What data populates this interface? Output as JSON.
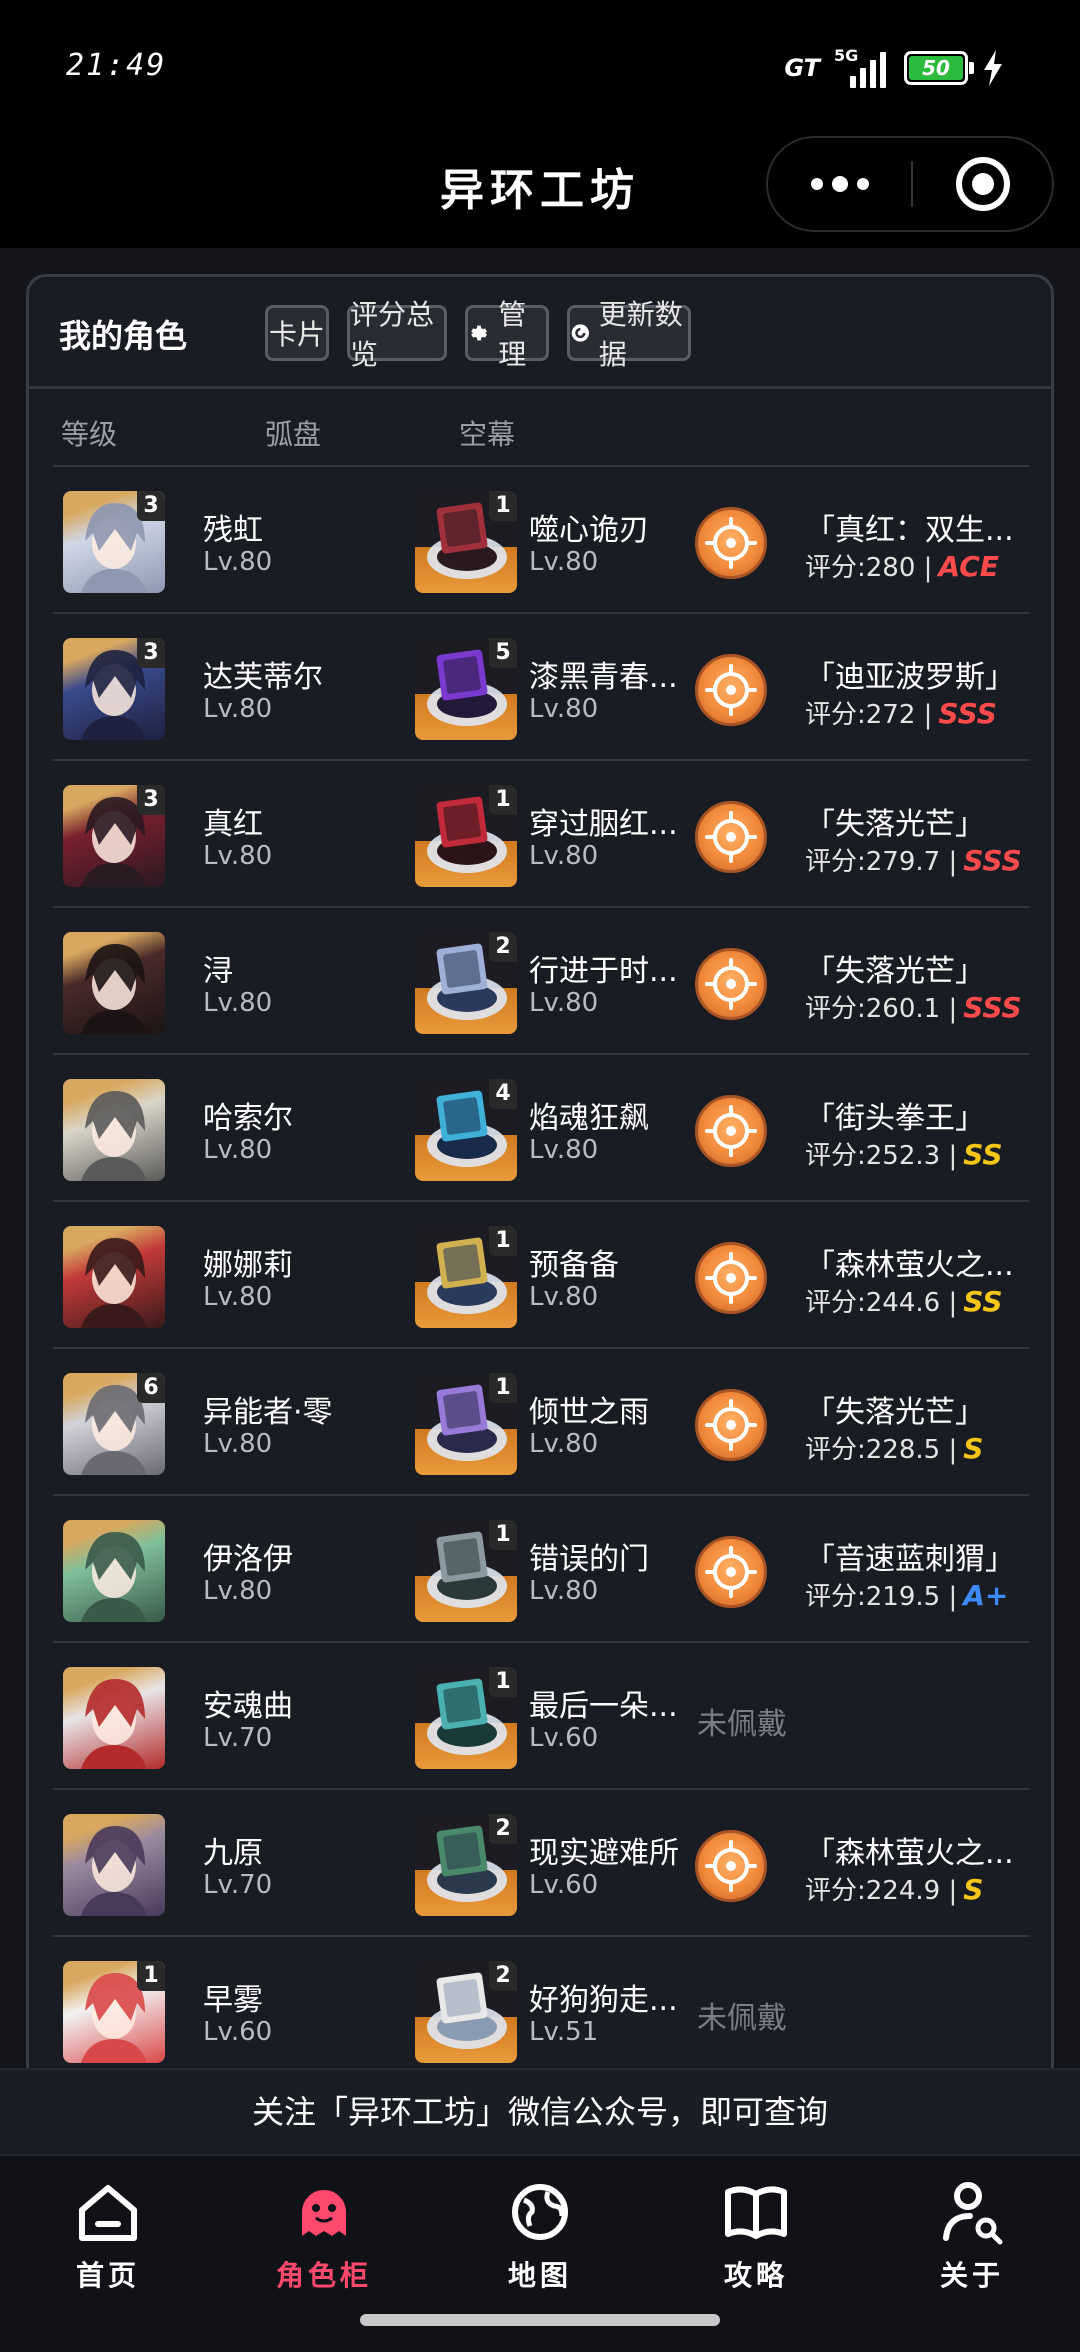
{
  "status": {
    "time": "21:49",
    "carrier_badge": "GT",
    "network": "5G",
    "battery": "50",
    "battery_color": "#2cbb3c"
  },
  "titlebar": {
    "title": "异环工坊",
    "more_icon": "more-dots-icon",
    "close_icon": "target-ring-icon"
  },
  "panel": {
    "title": "我的角色",
    "buttons": {
      "card": "卡片",
      "overview": "评分总览",
      "manage": "管理",
      "update": "更新数据"
    },
    "columns": {
      "level": "等级",
      "disk": "弧盘",
      "core": "空幕"
    }
  },
  "characters": [
    {
      "name": "残虹",
      "level": "Lv.80",
      "stars": "3",
      "disk": "噬心诡刃",
      "disk_level": "Lv.80",
      "disk_stars": "1",
      "core": "「真红：双生...",
      "score": "评分:280 |",
      "grade": "ACE",
      "grade_color": "#ff4b4b",
      "core_icon": "target-emblem-icon",
      "equipped": true
    },
    {
      "name": "达芙蒂尔",
      "level": "Lv.80",
      "stars": "3",
      "disk": "漆黑青春...",
      "disk_level": "Lv.80",
      "disk_stars": "5",
      "core": "「迪亚波罗斯」",
      "score": "评分:272 |",
      "grade": "SSS",
      "grade_color": "#ff4b4b",
      "core_icon": "moon-emblem-icon",
      "equipped": true
    },
    {
      "name": "真红",
      "level": "Lv.80",
      "stars": "3",
      "disk": "穿过胭红...",
      "disk_level": "Lv.80",
      "disk_stars": "1",
      "core": "「失落光芒」",
      "score": "评分:279.7 |",
      "grade": "SSS",
      "grade_color": "#ff4b4b",
      "core_icon": "sun-emblem-icon",
      "equipped": true
    },
    {
      "name": "浔",
      "level": "Lv.80",
      "stars": "",
      "disk": "行进于时...",
      "disk_level": "Lv.80",
      "disk_stars": "2",
      "core": "「失落光芒」",
      "score": "评分:260.1 |",
      "grade": "SSS",
      "grade_color": "#ff4b4b",
      "core_icon": "sun-emblem-icon",
      "equipped": true
    },
    {
      "name": "哈索尔",
      "level": "Lv.80",
      "stars": "",
      "disk": "焰魂狂飙",
      "disk_level": "Lv.80",
      "disk_stars": "4",
      "core": "「街头拳王」",
      "score": "评分:252.3 |",
      "grade": "SS",
      "grade_color": "#f5c518",
      "core_icon": "star-emblem-icon",
      "equipped": true
    },
    {
      "name": "娜娜莉",
      "level": "Lv.80",
      "stars": "",
      "disk": "预备备",
      "disk_level": "Lv.80",
      "disk_stars": "1",
      "core": "「森林萤火之...",
      "score": "评分:244.6 |",
      "grade": "SS",
      "grade_color": "#f5c518",
      "core_icon": "flame-emblem-icon",
      "equipped": true
    },
    {
      "name": "异能者·零",
      "level": "Lv.80",
      "stars": "6",
      "disk": "倾世之雨",
      "disk_level": "Lv.80",
      "disk_stars": "1",
      "core": "「失落光芒」",
      "score": "评分:228.5 |",
      "grade": "S",
      "grade_color": "#f5c518",
      "core_icon": "sun-emblem-icon",
      "equipped": true
    },
    {
      "name": "伊洛伊",
      "level": "Lv.80",
      "stars": "",
      "disk": "错误的门",
      "disk_level": "Lv.80",
      "disk_stars": "1",
      "core": "「音速蓝刺猬」",
      "score": "评分:219.5 |",
      "grade": "A+",
      "grade_color": "#3d8bff",
      "core_icon": "ring-emblem-icon",
      "equipped": true
    },
    {
      "name": "安魂曲",
      "level": "Lv.70",
      "stars": "",
      "disk": "最后一朵...",
      "disk_level": "Lv.60",
      "disk_stars": "1",
      "core": "",
      "score": "",
      "grade": "",
      "grade_color": "",
      "core_icon": "",
      "equipped": false,
      "unequipped_label": "未佩戴"
    },
    {
      "name": "九原",
      "level": "Lv.70",
      "stars": "",
      "disk": "现实避难所",
      "disk_level": "Lv.60",
      "disk_stars": "2",
      "core": "「森林萤火之...",
      "score": "评分:224.9 |",
      "grade": "S",
      "grade_color": "#f5c518",
      "core_icon": "flame-emblem-icon",
      "equipped": true
    },
    {
      "name": "早雾",
      "level": "Lv.60",
      "stars": "1",
      "disk": "好狗狗走...",
      "disk_level": "Lv.51",
      "disk_stars": "2",
      "core": "",
      "score": "",
      "grade": "",
      "grade_color": "",
      "core_icon": "",
      "equipped": false,
      "unequipped_label": "未佩戴"
    }
  ],
  "banner": {
    "text": "关注「异环工坊」微信公众号，即可查询"
  },
  "tabs": [
    {
      "label": "首页",
      "icon": "home-icon",
      "active": false
    },
    {
      "label": "角色柜",
      "icon": "ghost-icon",
      "active": true
    },
    {
      "label": "地图",
      "icon": "globe-icon",
      "active": false
    },
    {
      "label": "攻略",
      "icon": "book-icon",
      "active": false
    },
    {
      "label": "关于",
      "icon": "user-search-icon",
      "active": false
    }
  ],
  "colors": {
    "accent": "#ff4a6e",
    "panel_bg": "#1a1c23",
    "page_bg": "#14161c",
    "core_orange": "#f28a3a"
  }
}
